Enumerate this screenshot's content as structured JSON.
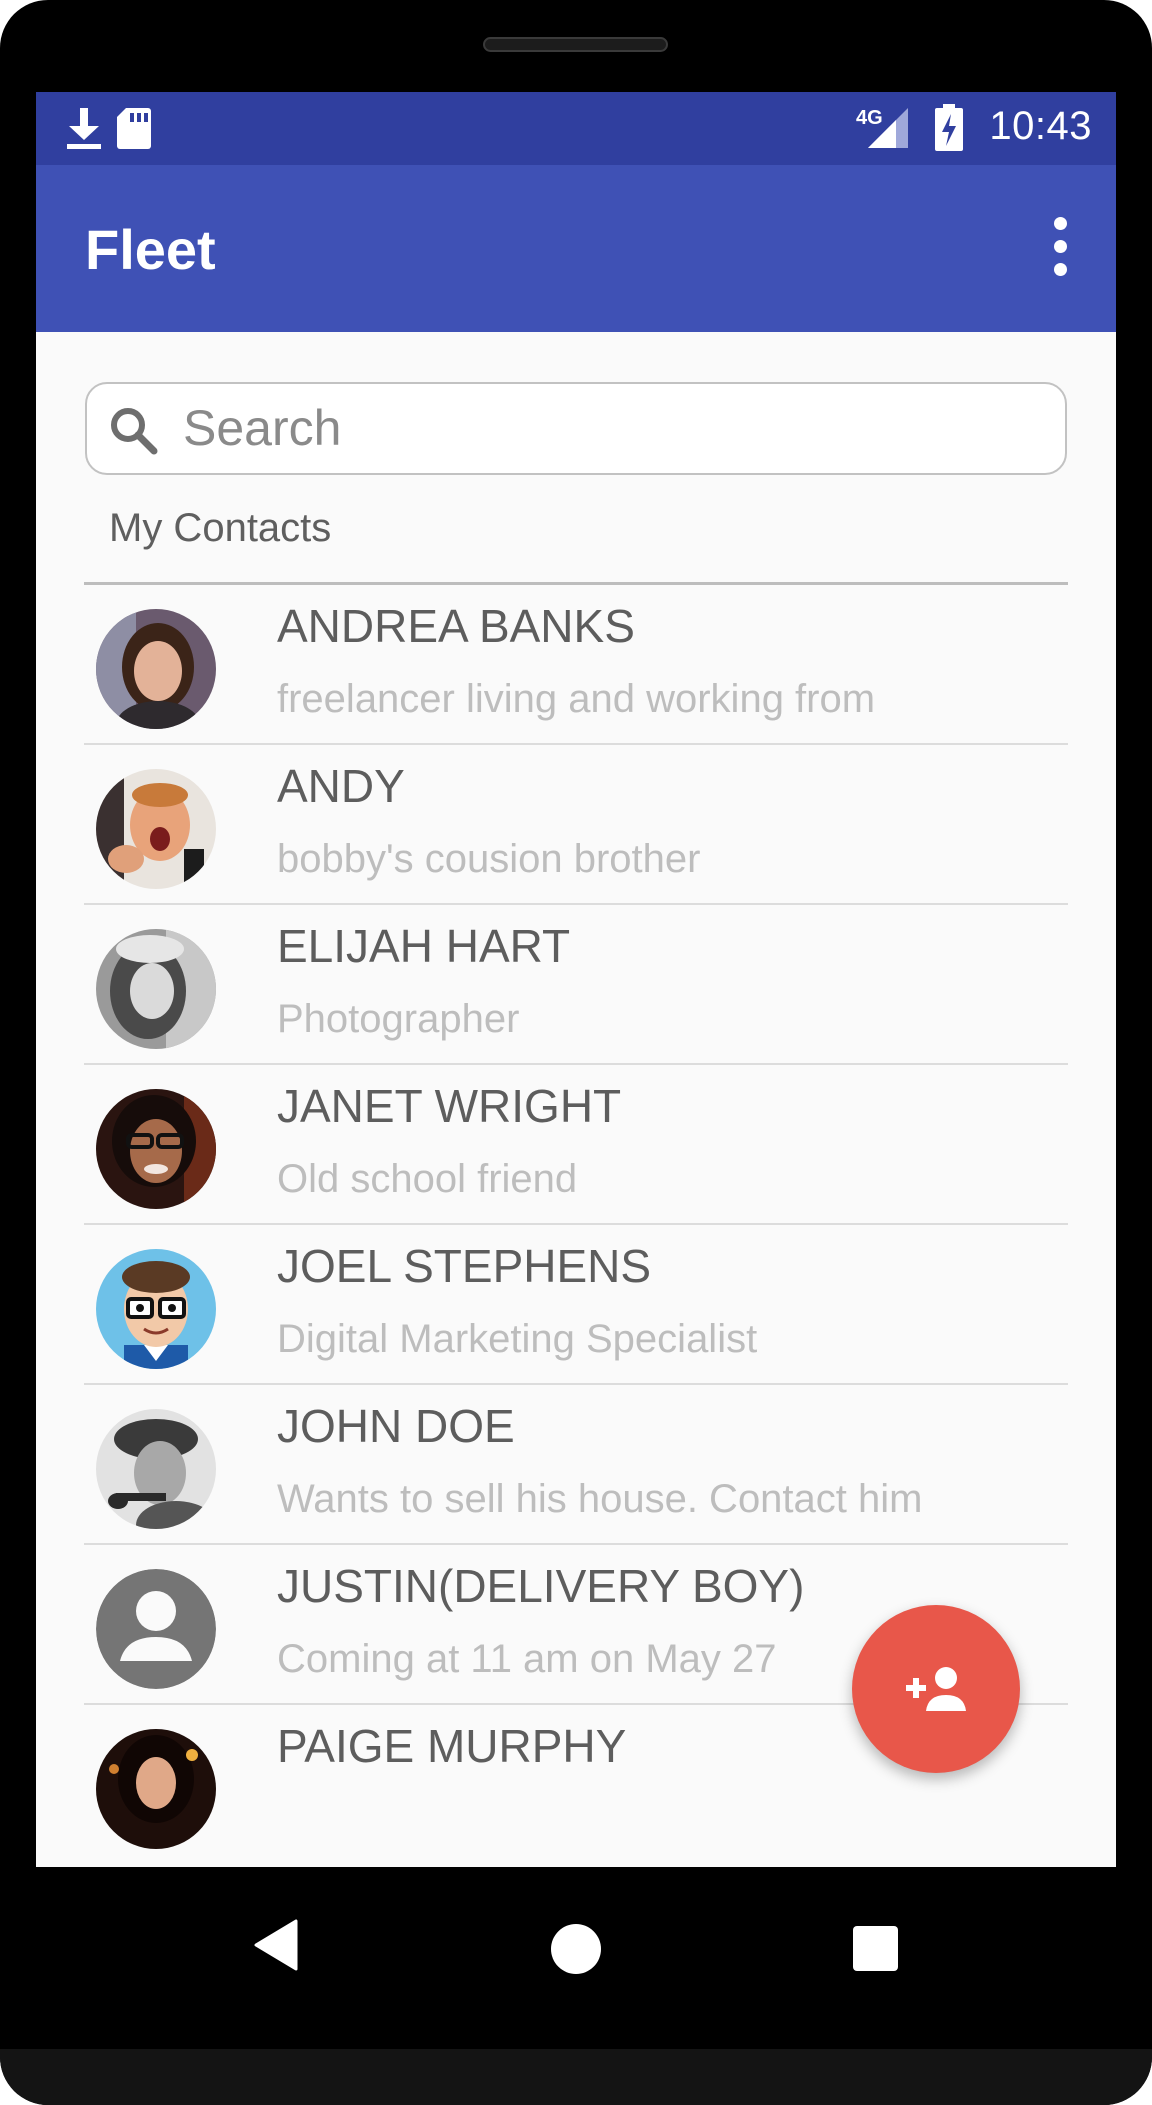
{
  "status_bar": {
    "time": "10:43",
    "network": "4G",
    "icons": [
      "download-icon",
      "sd-card-icon",
      "signal-4g-icon",
      "battery-charging-icon"
    ]
  },
  "app_bar": {
    "title": "Fleet",
    "menu_icon": "more-vert-icon"
  },
  "search": {
    "placeholder": "Search",
    "value": ""
  },
  "section": {
    "title": "My Contacts"
  },
  "contacts": [
    {
      "name": "ANDREA BANKS",
      "description": "freelancer living and working from"
    },
    {
      "name": "ANDY",
      "description": "bobby's cousion brother"
    },
    {
      "name": "ELIJAH HART",
      "description": "Photographer"
    },
    {
      "name": "JANET WRIGHT",
      "description": "Old school friend"
    },
    {
      "name": "JOEL STEPHENS",
      "description": "Digital Marketing Specialist"
    },
    {
      "name": "JOHN DOE",
      "description": "Wants to sell his house. Contact him"
    },
    {
      "name": "JUSTIN(DELIVERY BOY)",
      "description": "Coming at 11 am on May 27"
    },
    {
      "name": "PAIGE MURPHY",
      "description": ""
    }
  ],
  "fab": {
    "icon": "add-person-icon",
    "color": "#E8574A"
  },
  "nav_bar": {
    "icons": [
      "back-icon",
      "home-icon",
      "recents-icon"
    ]
  },
  "colors": {
    "primary": "#3F51B5",
    "primary_dark": "#303F9F",
    "accent": "#E8574A"
  }
}
